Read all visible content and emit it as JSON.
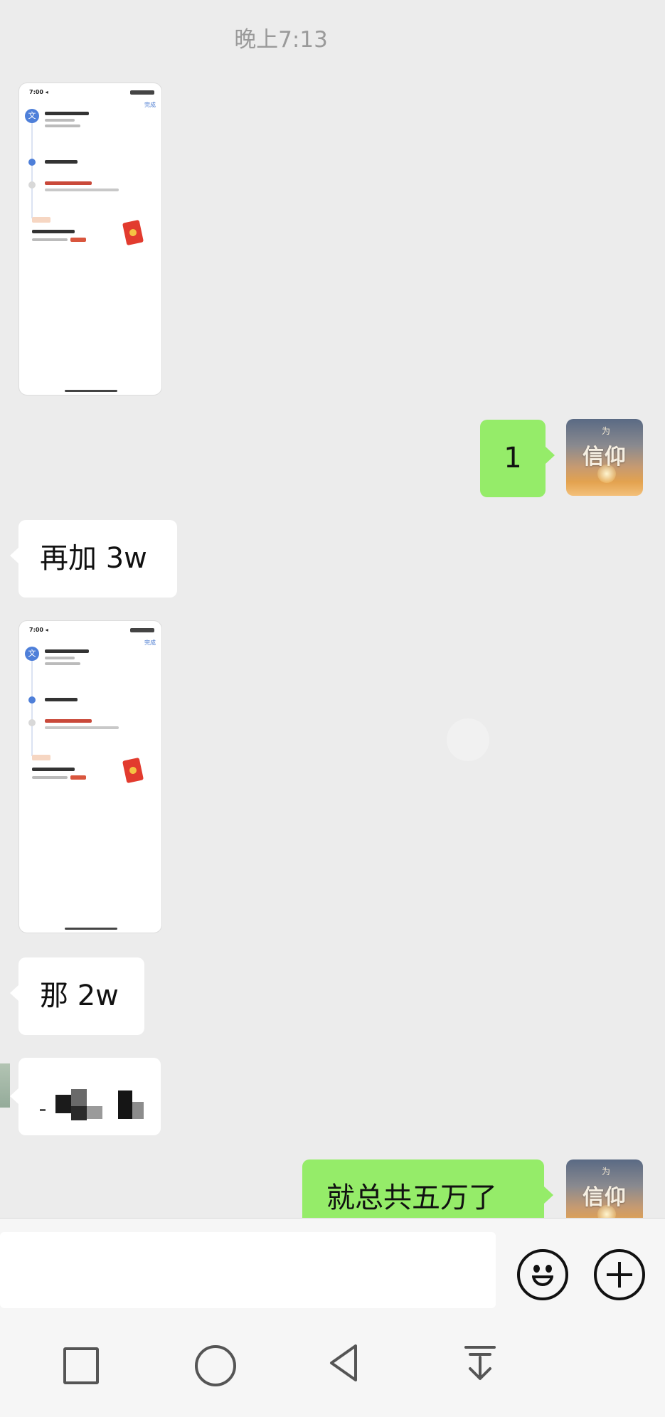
{
  "chat": {
    "timestamp": "晚上7:13",
    "messages": [
      {
        "side": "in",
        "type": "image",
        "desc": "screenshot"
      },
      {
        "side": "out",
        "type": "text",
        "text": "1"
      },
      {
        "side": "in",
        "type": "text",
        "text": "再加 3w"
      },
      {
        "side": "in",
        "type": "image",
        "desc": "screenshot"
      },
      {
        "side": "in",
        "type": "text",
        "text": "那 2w"
      },
      {
        "side": "in",
        "type": "text",
        "text": ""
      },
      {
        "side": "out",
        "type": "text",
        "text": "就总共五万了"
      }
    ]
  },
  "avatar": {
    "text": "信仰",
    "small": "为"
  },
  "input_bar": {
    "emoji_icon": "smiley-icon",
    "plus_icon": "plus-circle-icon"
  },
  "nav_bar": {
    "icons": [
      "recent-apps-icon",
      "home-icon",
      "back-icon",
      "notification-pull-icon"
    ]
  },
  "colors": {
    "outgoing_bubble": "#95ec69",
    "incoming_bubble": "#ffffff",
    "background": "#ededed",
    "accent_blue": "#4e7fd9"
  }
}
